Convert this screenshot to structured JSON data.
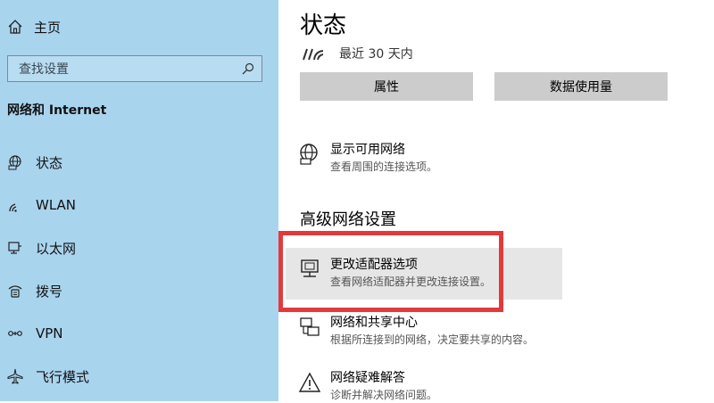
{
  "sidebar": {
    "home_label": "主页",
    "search_placeholder": "查找设置",
    "section_title": "网络和 Internet",
    "items": [
      {
        "label": "状态",
        "icon": "globe-status-icon"
      },
      {
        "label": "WLAN",
        "icon": "wifi-icon"
      },
      {
        "label": "以太网",
        "icon": "ethernet-icon"
      },
      {
        "label": "拨号",
        "icon": "dialup-icon"
      },
      {
        "label": "VPN",
        "icon": "vpn-icon"
      },
      {
        "label": "飞行模式",
        "icon": "airplane-icon"
      }
    ]
  },
  "main": {
    "title": "状态",
    "status_text": "最近 30 天内",
    "buttons": {
      "properties": "属性",
      "data_usage": "数据使用量"
    },
    "show_networks": {
      "title": "显示可用网络",
      "desc": "查看周围的连接选项。"
    },
    "advanced_title": "高级网络设置",
    "advanced_items": [
      {
        "title": "更改适配器选项",
        "desc": "查看网络适配器并更改连接设置。"
      },
      {
        "title": "网络和共享中心",
        "desc": "根据所连接到的网络，决定要共享的内容。"
      },
      {
        "title": "网络疑难解答",
        "desc": "诊断并解决网络问题。"
      }
    ]
  },
  "colors": {
    "sidebar_bg": "#a9d4ee",
    "button_bg": "#cccccc",
    "highlight": "#e23a3a",
    "selected_bg": "#e6e6e6"
  }
}
